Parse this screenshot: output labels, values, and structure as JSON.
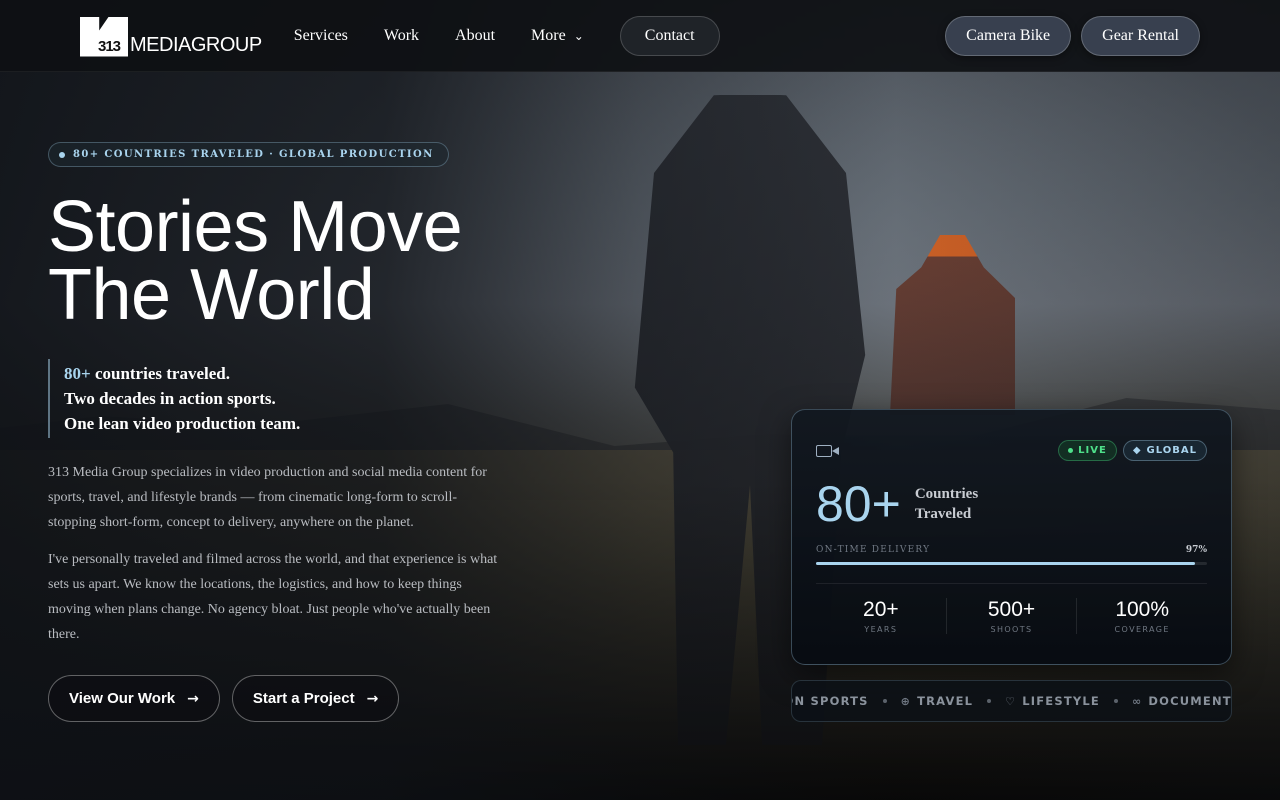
{
  "nav": {
    "logo_mark": "313",
    "logo_text": "MEDIAGROUP",
    "links": [
      {
        "label": "Services"
      },
      {
        "label": "Work"
      },
      {
        "label": "About"
      },
      {
        "label": "More"
      }
    ],
    "contact_label": "Contact",
    "camera_bike_label": "Camera Bike",
    "gear_rental_label": "Gear Rental"
  },
  "hero": {
    "badge": "80+ COUNTRIES TRAVELED · GLOBAL PRODUCTION",
    "title_line1": "Stories Move",
    "title_line2": "The World",
    "quote": {
      "accent": "80+",
      "line1_rest": " countries traveled.",
      "line2": "Two decades in action sports.",
      "line3": "One lean video production team."
    },
    "para1": "313 Media Group specializes in video production and social media content for sports, travel, and lifestyle brands — from cinematic long-form to scroll-stopping short-form, concept to delivery, anywhere on the planet.",
    "para2": "I've personally traveled and filmed across the world, and that experience is what sets us apart. We know the locations, the logistics, and how to keep things moving when plans change. No agency bloat. Just people who've actually been there.",
    "cta_work": "View Our Work",
    "cta_project": "Start a Project"
  },
  "card": {
    "tag_live": "LIVE",
    "tag_global": "GLOBAL",
    "big_value": "80+",
    "big_label_1": "Countries",
    "big_label_2": "Traveled",
    "delivery_label": "ON-TIME DELIVERY",
    "delivery_pct": "97%",
    "delivery_fraction": 0.97,
    "stats": [
      {
        "value": "20+",
        "label": "YEARS"
      },
      {
        "value": "500+",
        "label": "SHOOTS"
      },
      {
        "value": "100%",
        "label": "COVERAGE"
      }
    ]
  },
  "marquee": {
    "items": [
      "ION SPORTS",
      "TRAVEL",
      "LIFESTYLE",
      "DOCUMENT"
    ]
  },
  "colors": {
    "accent": "#a9d4ee",
    "live": "#4ee08a"
  }
}
